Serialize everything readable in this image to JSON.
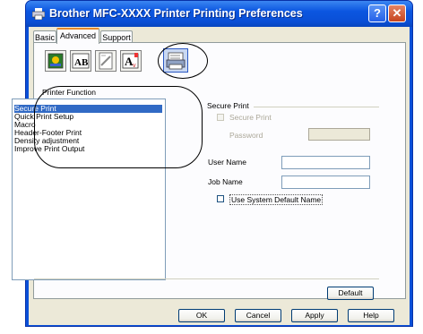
{
  "window": {
    "title": "Brother MFC-XXXX Printer Printing Preferences",
    "help_label": "?",
    "close_label": "✕"
  },
  "tabs": [
    {
      "label": "Basic",
      "active": false
    },
    {
      "label": "Advanced",
      "active": true
    },
    {
      "label": "Support",
      "active": false
    }
  ],
  "toolbar": {
    "icons": [
      "color-page-icon",
      "text-ab-icon",
      "watermark-page-icon",
      "font-a-icon",
      "printer-settings-icon"
    ]
  },
  "printer_function": {
    "label": "Printer Function",
    "items": [
      "Secure Print",
      "Quick Print Setup",
      "Macro",
      "Header-Footer Print",
      "Density adjustment",
      "Improve Print Output"
    ],
    "selected_index": 0
  },
  "secure_print": {
    "group_label": "Secure Print",
    "checkbox_label": "Secure Print",
    "password_label": "Password",
    "password_value": "",
    "user_name_label": "User Name",
    "user_name_value": "",
    "job_name_label": "Job Name",
    "job_name_value": "",
    "use_default_label": "Use System Default Name"
  },
  "buttons": {
    "default": "Default",
    "ok": "OK",
    "cancel": "Cancel",
    "apply": "Apply",
    "help": "Help"
  },
  "colors": {
    "title_bar": "#0a50d8",
    "selection": "#316ac5",
    "dialog_bg": "#ece9d8"
  }
}
